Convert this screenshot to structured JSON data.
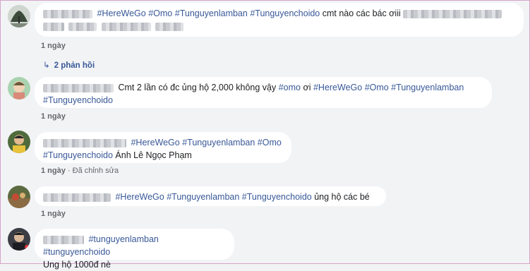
{
  "comments": [
    {
      "segments": [
        {
          "type": "tag",
          "text": "#HereWeGo"
        },
        {
          "type": "tag",
          "text": "#Omo"
        },
        {
          "type": "tag",
          "text": "#Tunguyenlamban"
        },
        {
          "type": "tag",
          "text": "#Tunguyenchoido"
        },
        {
          "type": "text",
          "text": "cmt nào các bác ơiii"
        }
      ],
      "time": "1 ngày",
      "edited": ""
    },
    {
      "segments": [
        {
          "type": "text",
          "text": "Cmt 2 lần có đc ủng hộ 2,000 không vậy"
        },
        {
          "type": "tag",
          "text": "#omo"
        },
        {
          "type": "text",
          "text": "ơi"
        },
        {
          "type": "tag",
          "text": "#HereWeGo"
        },
        {
          "type": "tag",
          "text": "#Omo"
        },
        {
          "type": "tag",
          "text": "#Tunguyenlamban"
        },
        {
          "type": "tag",
          "text": "#Tunguyenchoido"
        }
      ],
      "time": "1 ngày",
      "edited": ""
    },
    {
      "segments": [
        {
          "type": "tag",
          "text": "#HereWeGo"
        },
        {
          "type": "tag",
          "text": "#Tunguyenlamban"
        },
        {
          "type": "tag",
          "text": "#Omo"
        },
        {
          "type": "tag",
          "text": "#Tunguyenchoido"
        },
        {
          "type": "text",
          "text": "Ánh Lê Ngọc Phạm"
        }
      ],
      "time": "1 ngày",
      "edited": "Đã chỉnh sửa"
    },
    {
      "segments": [
        {
          "type": "tag",
          "text": "#HereWeGo"
        },
        {
          "type": "tag",
          "text": "#Tunguyenlamban"
        },
        {
          "type": "tag",
          "text": "#Tunguyenchoido"
        },
        {
          "type": "text",
          "text": "ủng hộ các bé"
        }
      ],
      "time": "1 ngày",
      "edited": ""
    },
    {
      "segments": [
        {
          "type": "tag",
          "text": "#tunguyenlamban"
        },
        {
          "type": "tag",
          "text": "#tunguyenchoido"
        },
        {
          "type": "text",
          "text": "Ung hộ 1000đ nè"
        }
      ],
      "time": "",
      "edited": ""
    }
  ],
  "replies_label": "2 phản hồi",
  "colors": {
    "link": "#385898",
    "background": "#f2f3f5",
    "bubble": "#ffffff"
  }
}
